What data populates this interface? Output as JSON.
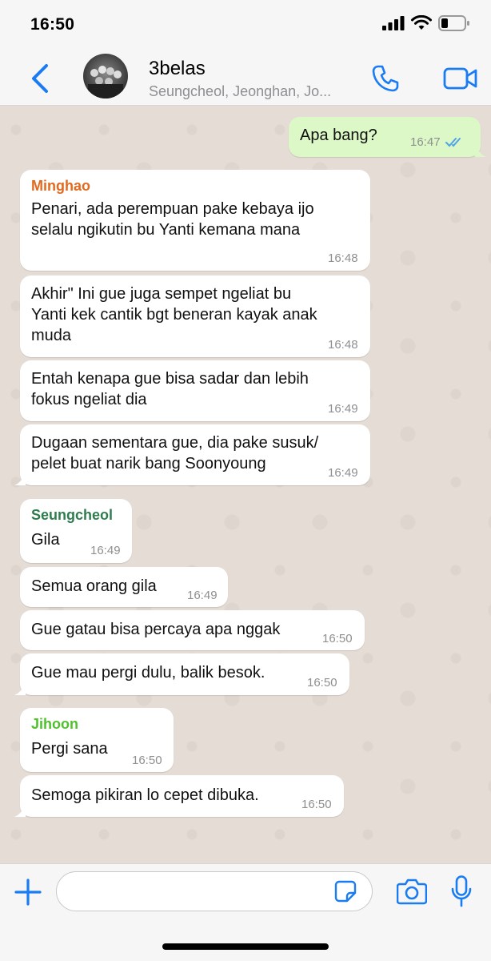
{
  "status_bar": {
    "time": "16:50"
  },
  "header": {
    "title": "3belas",
    "subtitle": "Seungcheol, Jeonghan, Jo..."
  },
  "colors": {
    "ios_blue": "#1a7cf3",
    "outgoing_bubble": "#dcf8c6",
    "chat_background": "#e5ddd5",
    "minghao": "#e3691e",
    "seungcheol": "#2e7d4f",
    "jihoon": "#4ec12c",
    "read_ticks": "#4fa3e8"
  },
  "icons": {
    "back": "chevron-left-icon",
    "call": "phone-icon",
    "video": "video-camera-icon",
    "attach": "plus-icon",
    "sticker": "sticker-icon",
    "camera": "camera-icon",
    "mic": "microphone-icon"
  },
  "messages": [
    {
      "direction": "out",
      "text": "Apa bang?",
      "time": "16:47",
      "read": true
    },
    {
      "direction": "in",
      "sender": "Minghao",
      "lines": [
        "Penari, ada perempuan pake kebaya ijo",
        "selalu ngikutin bu Yanti kemana mana"
      ],
      "time": "16:48"
    },
    {
      "direction": "in",
      "lines": [
        "Akhir\" Ini gue juga sempet ngeliat bu",
        "Yanti kek cantik bgt beneran kayak anak",
        "muda"
      ],
      "time": "16:48"
    },
    {
      "direction": "in",
      "lines": [
        "Entah kenapa gue bisa sadar dan lebih",
        "fokus ngeliat dia"
      ],
      "time": "16:49"
    },
    {
      "direction": "in",
      "lines": [
        "Dugaan sementara gue, dia pake susuk/",
        "pelet buat narik bang Soonyoung"
      ],
      "time": "16:49"
    },
    {
      "direction": "in",
      "sender": "Seungcheol",
      "lines": [
        "Gila"
      ],
      "time": "16:49"
    },
    {
      "direction": "in",
      "lines": [
        "Semua orang gila"
      ],
      "time": "16:49"
    },
    {
      "direction": "in",
      "lines": [
        "Gue gatau bisa percaya apa nggak"
      ],
      "time": "16:50"
    },
    {
      "direction": "in",
      "lines": [
        "Gue mau pergi dulu, balik besok."
      ],
      "time": "16:50"
    },
    {
      "direction": "in",
      "sender": "Jihoon",
      "lines": [
        "Pergi sana"
      ],
      "time": "16:50"
    },
    {
      "direction": "in",
      "lines": [
        "Semoga pikiran lo cepet dibuka."
      ],
      "time": "16:50"
    }
  ],
  "composer": {
    "placeholder": "",
    "value": ""
  }
}
